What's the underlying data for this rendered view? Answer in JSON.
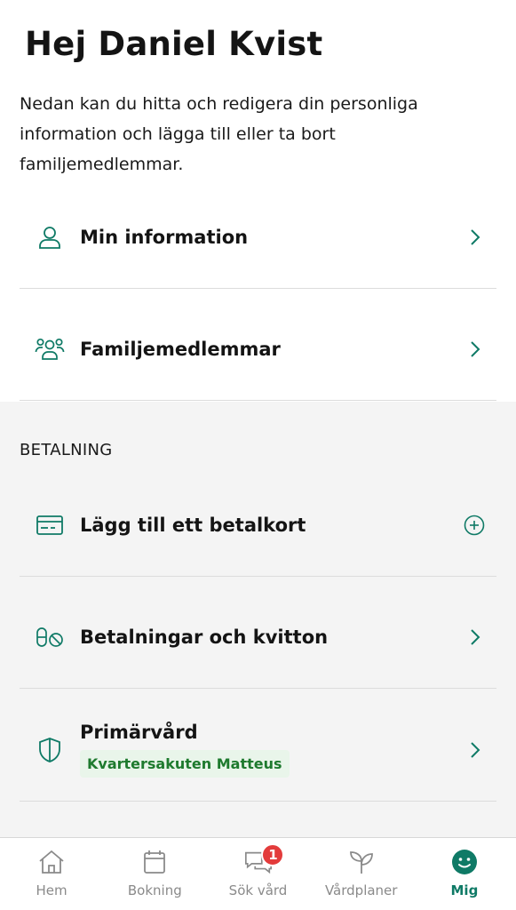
{
  "header": {
    "greeting": "Hej Daniel Kvist",
    "intro": "Nedan kan du hitta och redigera din personliga information och lägga till eller ta bort familjemedlemmar."
  },
  "profile_items": [
    {
      "label": "Min information",
      "icon": "person-icon"
    },
    {
      "label": "Familjemedlemmar",
      "icon": "family-icon"
    }
  ],
  "payment": {
    "section_title": "BETALNING",
    "items": [
      {
        "label": "Lägg till ett betalkort",
        "icon": "credit-card-icon",
        "action_icon": "add-circle-icon"
      },
      {
        "label": "Betalningar och kvitton",
        "icon": "pills-icon"
      }
    ]
  },
  "primary_care": {
    "label": "Primärvård",
    "clinic": "Kvartersakuten Matteus",
    "icon": "shield-icon"
  },
  "tabbar": {
    "tabs": [
      {
        "label": "Hem",
        "icon": "home-icon"
      },
      {
        "label": "Bokning",
        "icon": "calendar-icon"
      },
      {
        "label": "Sök vård",
        "icon": "chat-bubbles-icon",
        "badge": "1"
      },
      {
        "label": "Vårdplaner",
        "icon": "sprout-icon"
      },
      {
        "label": "Mig",
        "icon": "smiley-icon",
        "active": true
      }
    ]
  },
  "colors": {
    "accent": "#0f7a66",
    "badge": "#e33b3b",
    "chip_bg": "#e9f5ea",
    "chip_text": "#1e7a2e",
    "section_bg": "#f4f4f4"
  }
}
